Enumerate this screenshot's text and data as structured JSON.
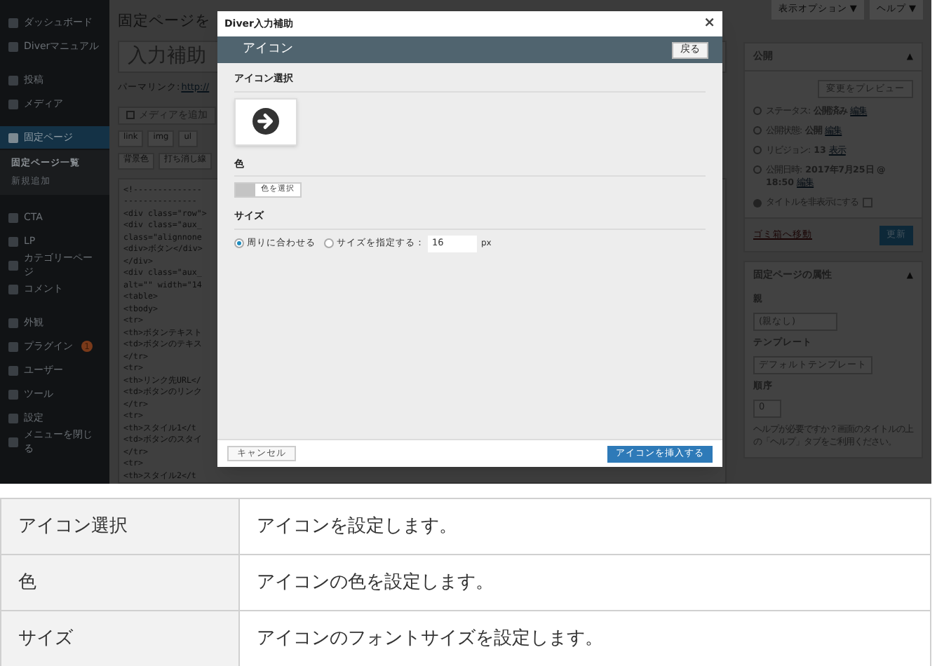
{
  "admin_menu": {
    "items": [
      {
        "label": "ダッシュボード",
        "selected": false
      },
      {
        "label": "Diverマニュアル",
        "selected": false
      },
      {
        "label": "投稿",
        "selected": false
      },
      {
        "label": "メディア",
        "selected": false
      },
      {
        "label": "固定ページ",
        "selected": true,
        "children": [
          {
            "label": "固定ページ一覧",
            "selected": true
          },
          {
            "label": "新規追加",
            "selected": false
          }
        ]
      },
      {
        "label": "CTA",
        "selected": false
      },
      {
        "label": "LP",
        "selected": false
      },
      {
        "label": "カテゴリーページ",
        "selected": false
      },
      {
        "label": "コメント",
        "selected": false
      },
      {
        "label": "外観",
        "selected": false
      },
      {
        "label": "プラグイン",
        "selected": false,
        "badge": "1"
      },
      {
        "label": "ユーザー",
        "selected": false
      },
      {
        "label": "ツール",
        "selected": false
      },
      {
        "label": "設定",
        "selected": false
      },
      {
        "label": "メニューを閉じる",
        "selected": false
      }
    ]
  },
  "editor": {
    "heading": "固定ページを",
    "title_value": "入力補助",
    "permalink_label": "パーマリンク:",
    "permalink_url": "http://",
    "media_button": "メディアを追加",
    "quicktags": [
      [
        "link",
        "img",
        "ul"
      ],
      [
        "背景色",
        "打ち消し線"
      ]
    ],
    "code_lines": [
      "<!--------------",
      "---------------",
      "<div class=\"row\">",
      "<div class=\"aux_",
      "class=\"alignnone",
      "<div>ボタン</div>",
      "</div>",
      "<div class=\"aux_",
      "alt=\"\" width=\"14",
      "<table>",
      "<tbody>",
      "<tr>",
      "<th>ボタンテキスト",
      "<td>ボタンのテキス",
      "</tr>",
      "<tr>",
      "<th>リンク先URL</",
      "<td>ボタンのリンク",
      "</tr>",
      "<tr>",
      "<th>スタイル1</t",
      "<td>ボタンのスタイ",
      "</tr>",
      "<tr>",
      "<th>スタイル2</t"
    ]
  },
  "screen_meta": [
    "表示オプション ▼",
    "ヘルプ ▼"
  ],
  "publish": {
    "title": "公開",
    "collapse_icon": "▲",
    "preview": "変更をプレビュー",
    "rows": [
      {
        "label": "ステータス:",
        "value": "公開済み",
        "link": "編集"
      },
      {
        "label": "公開状態:",
        "value": "公開",
        "link": "編集"
      },
      {
        "label": "リビジョン:",
        "value": "13",
        "link": "表示"
      },
      {
        "label": "公開日時:",
        "value": "2017年7月25日 @ 18:50",
        "link": "編集"
      }
    ],
    "hide_title": {
      "label": "タイトルを非表示にする",
      "checked": false
    },
    "trash": "ゴミ箱へ移動",
    "update": "更新"
  },
  "page_attributes": {
    "title": "固定ページの属性",
    "collapse_icon": "▲",
    "parent_label": "親",
    "parent_value": "(親なし)",
    "template_label": "テンプレート",
    "template_value": "デフォルトテンプレート",
    "order_label": "順序",
    "order_value": "0",
    "help": "ヘルプが必要ですか？画面のタイトルの上の「ヘルプ」タブをご利用ください。"
  },
  "modal": {
    "title": "Diver入力補助",
    "close": "×",
    "header": "アイコン",
    "back": "戻る",
    "sections": [
      {
        "kind": "icon",
        "label": "アイコン選択"
      },
      {
        "kind": "color",
        "label": "色",
        "button": "色を選択"
      },
      {
        "kind": "size",
        "label": "サイズ",
        "options": [
          {
            "label": "周りに合わせる",
            "selected": true
          },
          {
            "label": "サイズを指定する：",
            "selected": false
          }
        ],
        "value": "16",
        "unit": "px"
      }
    ],
    "cancel": "キャンセル",
    "insert": "アイコンを挿入する"
  },
  "table": {
    "rows": [
      [
        "アイコン選択",
        "アイコンを設定します。"
      ],
      [
        "色",
        "アイコンの色を設定します。"
      ],
      [
        "サイズ",
        "アイコンのフォントサイズを設定します。"
      ]
    ]
  }
}
